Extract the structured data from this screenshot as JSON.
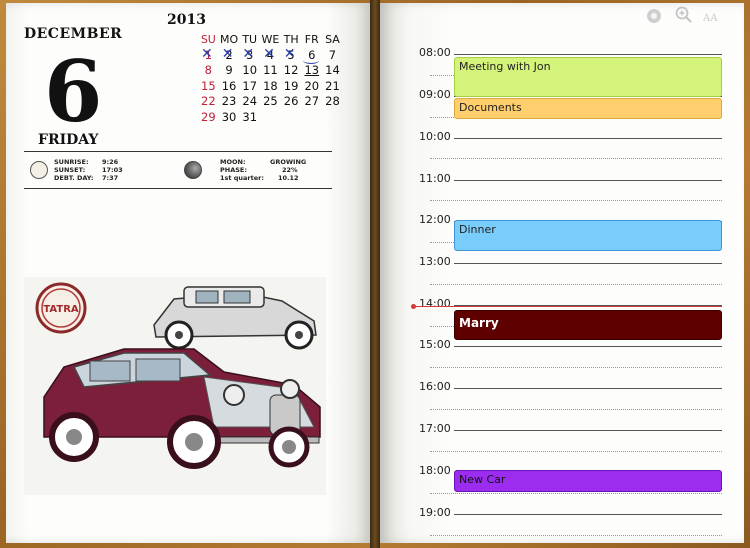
{
  "left_page": {
    "month": "DECEMBER",
    "day_number": "6",
    "weekday": "FRIDAY",
    "year": "2013",
    "mini_calendar": {
      "headers": [
        "SU",
        "MO",
        "TU",
        "WE",
        "TH",
        "FR",
        "SA"
      ],
      "weeks": [
        [
          "1",
          "2",
          "3",
          "4",
          "5",
          "6",
          "7"
        ],
        [
          "8",
          "9",
          "10",
          "11",
          "12",
          "13",
          "14"
        ],
        [
          "15",
          "16",
          "17",
          "18",
          "19",
          "20",
          "21"
        ],
        [
          "22",
          "23",
          "24",
          "25",
          "26",
          "27",
          "28"
        ],
        [
          "29",
          "30",
          "31",
          "",
          "",
          "",
          ""
        ]
      ],
      "sunday_color": "#c0203a",
      "mark_color": "#2a3fa8"
    },
    "sun_info": {
      "sunrise_label": "SUNRISE:",
      "sunrise": "9:26",
      "sunset_label": "SUNSET:",
      "sunset": "17:03",
      "debt_label": "DEBT. DAY:",
      "debt": "7:37"
    },
    "moon_info": {
      "moon_label": "MOON:",
      "moon": "GROWING",
      "phase_label": "PHASE:",
      "phase": "22%",
      "quarter_label": "1st quarter:",
      "quarter": "10.12"
    },
    "picture_badge": "TATRA"
  },
  "right_page": {
    "hours": [
      "08:00",
      "09:00",
      "10:00",
      "11:00",
      "12:00",
      "13:00",
      "14:00",
      "15:00",
      "16:00",
      "17:00",
      "18:00",
      "19:00"
    ],
    "events": [
      {
        "title": "Meeting with Jon",
        "color": "#d4f37a",
        "border": "#a8cf3f"
      },
      {
        "title": "Documents",
        "color": "#ffcf6e",
        "border": "#e0a83c"
      },
      {
        "title": "Dinner",
        "color": "#79cdfb",
        "border": "#3d96d8"
      },
      {
        "title": "Marry",
        "color": "#5e0000",
        "border": "#3a0000"
      },
      {
        "title": "New Car",
        "color": "#9b2cf0",
        "border": "#6b14b8"
      }
    ],
    "toolbar": {
      "settings_icon": "gear-icon",
      "zoom_icon": "zoom-in-icon",
      "font_label": "AA"
    },
    "now_line_color": "#d23a3a"
  }
}
